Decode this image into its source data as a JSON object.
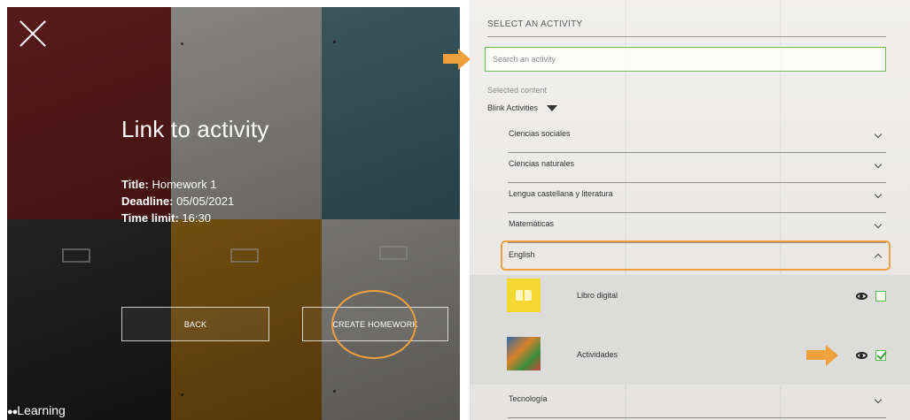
{
  "left": {
    "title": "Link to activity",
    "title_label": "Title:",
    "title_value": "Homework 1",
    "deadline_label": "Deadline:",
    "deadline_value": "05/05/2021",
    "time_label": "Time limit:",
    "time_value": "16:30",
    "back_button": "BACK",
    "create_button": "CREATE HOMEWORK",
    "brand": "Learning"
  },
  "right": {
    "heading": "SELECT AN ACTIVITY",
    "search_placeholder": "Search an activity",
    "selected_content_label": "Selected content",
    "source_selector": "Blink Activities",
    "subjects": [
      "Ciencias sociales",
      "Ciencias naturales",
      "Lengua castellana y literatura",
      "Matemáticas",
      "English",
      "Tecnología"
    ],
    "english_items": [
      {
        "title": "Libro digital",
        "checked": false
      },
      {
        "title": "Actividades",
        "checked": true
      }
    ]
  },
  "colors": {
    "highlight_orange": "#f0a03c",
    "search_border_green": "#6fbd55",
    "checkbox_green": "#5bbf52"
  }
}
